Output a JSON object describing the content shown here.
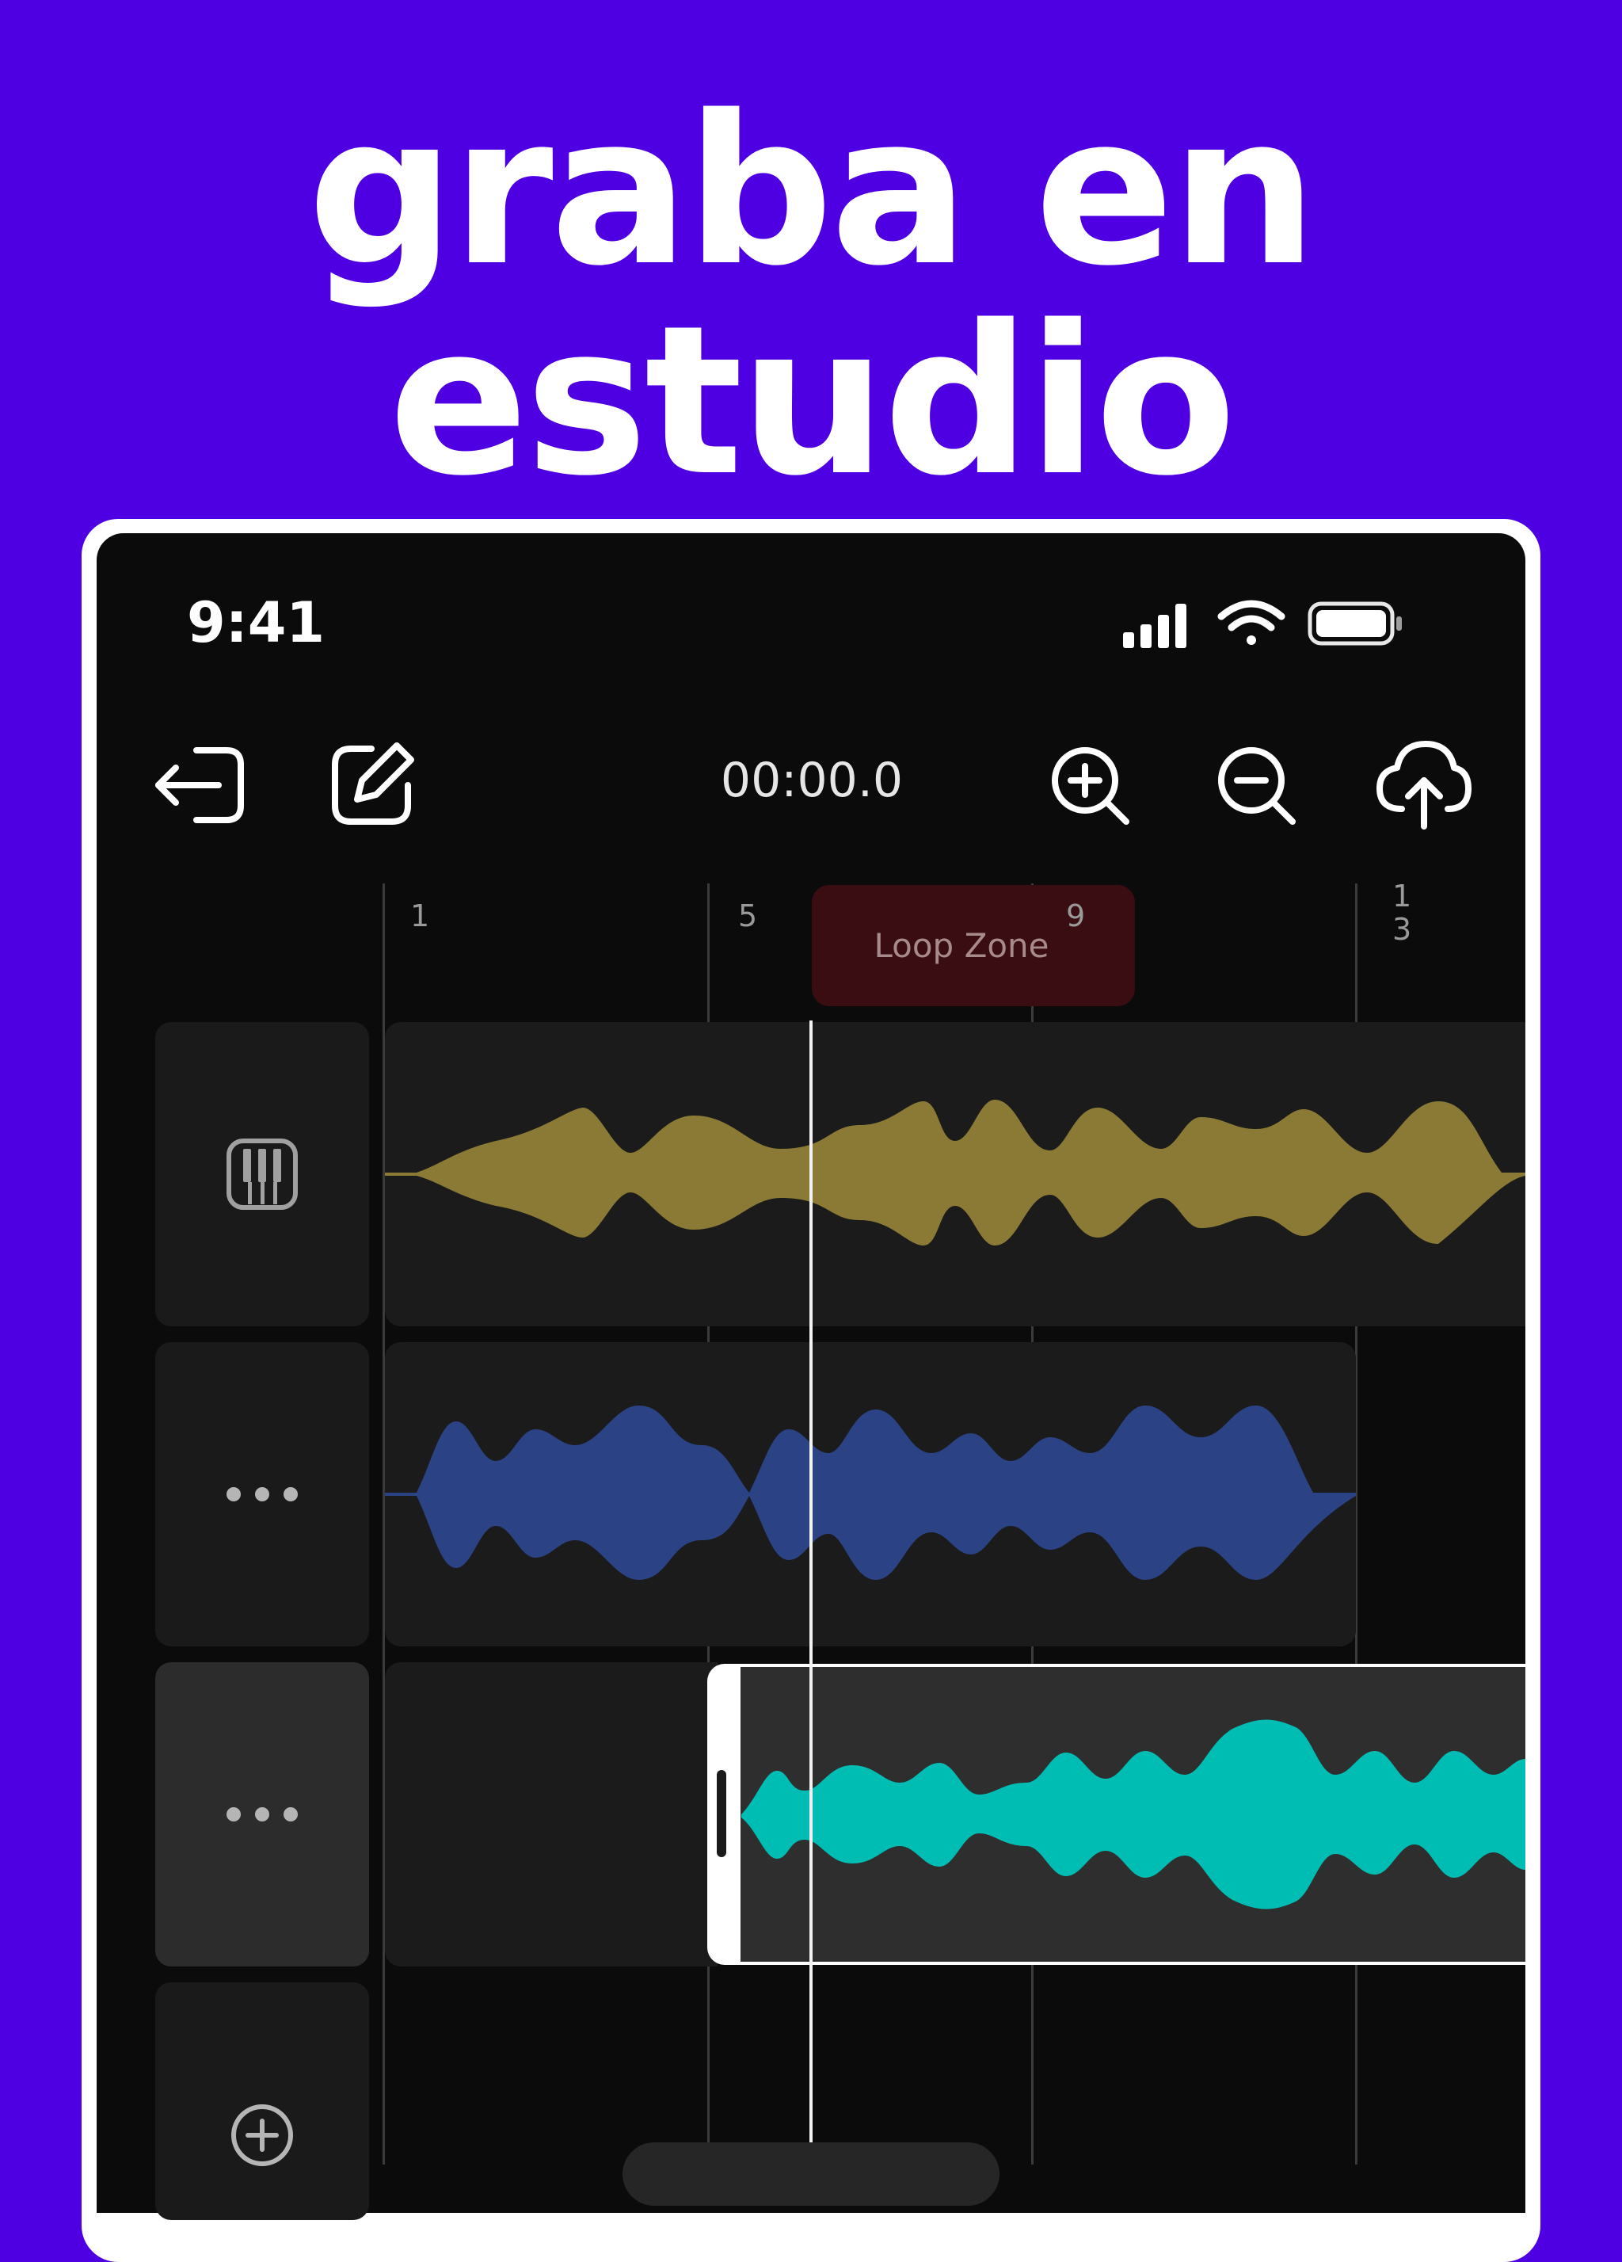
{
  "headline": {
    "line1": "graba en",
    "line2": "estudio"
  },
  "status_bar": {
    "time": "9:41"
  },
  "toolbar": {
    "timecode": "00:00.0",
    "icons": [
      "exit-icon",
      "edit-icon",
      "zoom-in-icon",
      "zoom-out-icon",
      "cloud-upload-icon"
    ]
  },
  "ruler": {
    "markers": [
      {
        "label": "1"
      },
      {
        "label": "5"
      },
      {
        "label": "9"
      },
      {
        "label": "1\n3"
      }
    ],
    "loop_zone": "Loop Zone"
  },
  "tracks": [
    {
      "icon": "piano-icon",
      "wave_color": "#8b7a35"
    },
    {
      "icon": "more-icon",
      "wave_color": "#2b4385"
    },
    {
      "icon": "more-icon",
      "wave_color": "#00bdb4",
      "selected": true
    },
    {
      "icon": "add-circle-icon"
    }
  ],
  "colors": {
    "background": "#4f00e3",
    "screen": "#0b0b0b",
    "accent_white": "#ffffff"
  }
}
